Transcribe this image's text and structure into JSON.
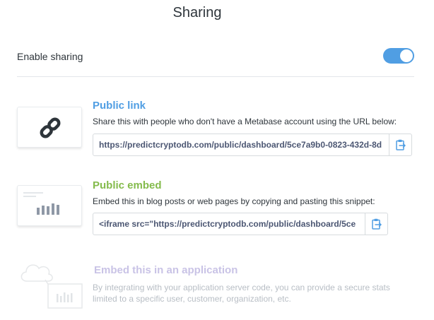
{
  "title": "Sharing",
  "enable_sharing": {
    "label": "Enable sharing",
    "enabled": true,
    "accent": "#509ee3"
  },
  "public_link": {
    "title": "Public link",
    "description": "Share this with people who don't have a Metabase account using the URL below:",
    "url": "https://predictcryptodb.com/public/dashboard/5ce7a9b0-0823-432d-8d",
    "title_color": "#509ee3",
    "icon": "link-icon",
    "copy_icon": "clipboard-icon"
  },
  "public_embed": {
    "title": "Public embed",
    "description": "Embed this in blog posts or web pages by copying and pasting this snippet:",
    "snippet": "<iframe   src=\"https://predictcryptodb.com/public/dashboard/5ce",
    "title_color": "#84bb4c",
    "icon": "embed-chart-icon",
    "copy_icon": "clipboard-icon"
  },
  "app_embed": {
    "title": "Embed this in an application",
    "description_line1": "By integrating with your application server code, you can provide a secure stats",
    "description_line2": "limited to a specific user, customer, organization, etc.",
    "title_color": "#c9c3e6",
    "text_color": "#b8bec5",
    "icon": "app-embed-icon"
  }
}
